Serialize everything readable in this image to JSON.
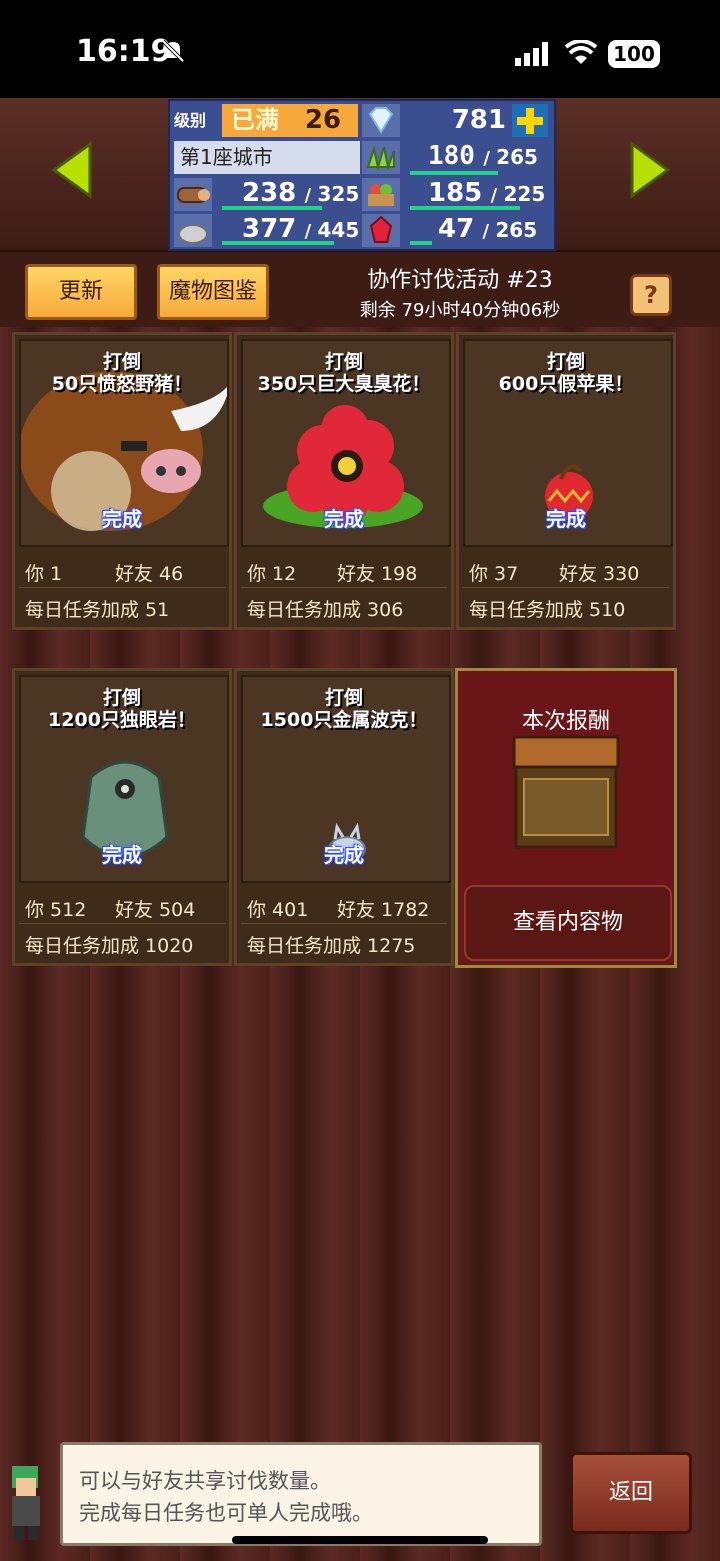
{
  "status_bar": {
    "time": "16:19",
    "battery": "100"
  },
  "stats": {
    "level_label": "级别",
    "level_status": "已满",
    "level_value": "26",
    "gems": "781",
    "city": "第1座城市",
    "grass_current": "180",
    "grass_max": "265",
    "wood_current": "238",
    "wood_max": "325",
    "food_current": "185",
    "food_max": "225",
    "stone_current": "377",
    "stone_max": "445",
    "ruby_current": "47",
    "ruby_max": "265"
  },
  "toolbar": {
    "refresh_label": "更新",
    "bestiary_label": "魔物图鉴",
    "event_title": "协作讨伐活动 #23",
    "event_time": "剩余 79小时40分钟06秒",
    "help_label": "?"
  },
  "cards": [
    {
      "mission_line1": "打倒",
      "mission_line2": "50只愤怒野猪！",
      "status": "完成",
      "you": "你 1",
      "friends": "好友 46",
      "daily": "每日任务加成 51"
    },
    {
      "mission_line1": "打倒",
      "mission_line2": "350只巨大臭臭花！",
      "status": "完成",
      "you": "你 12",
      "friends": "好友 198",
      "daily": "每日任务加成 306"
    },
    {
      "mission_line1": "打倒",
      "mission_line2": "600只假苹果！",
      "status": "完成",
      "you": "你 37",
      "friends": "好友 330",
      "daily": "每日任务加成 510"
    },
    {
      "mission_line1": "打倒",
      "mission_line2": "1200只独眼岩！",
      "status": "完成",
      "you": "你 512",
      "friends": "好友 504",
      "daily": "每日任务加成 1020"
    },
    {
      "mission_line1": "打倒",
      "mission_line2": "1500只金属波克！",
      "status": "完成",
      "you": "你 401",
      "friends": "好友 1782",
      "daily": "每日任务加成 1275"
    }
  ],
  "reward": {
    "title": "本次报酬",
    "button": "查看内容物"
  },
  "dialog": {
    "line1": "可以与好友共享讨伐数量。",
    "line2": "完成每日任务也可单人完成哦。"
  },
  "back_label": "返回"
}
